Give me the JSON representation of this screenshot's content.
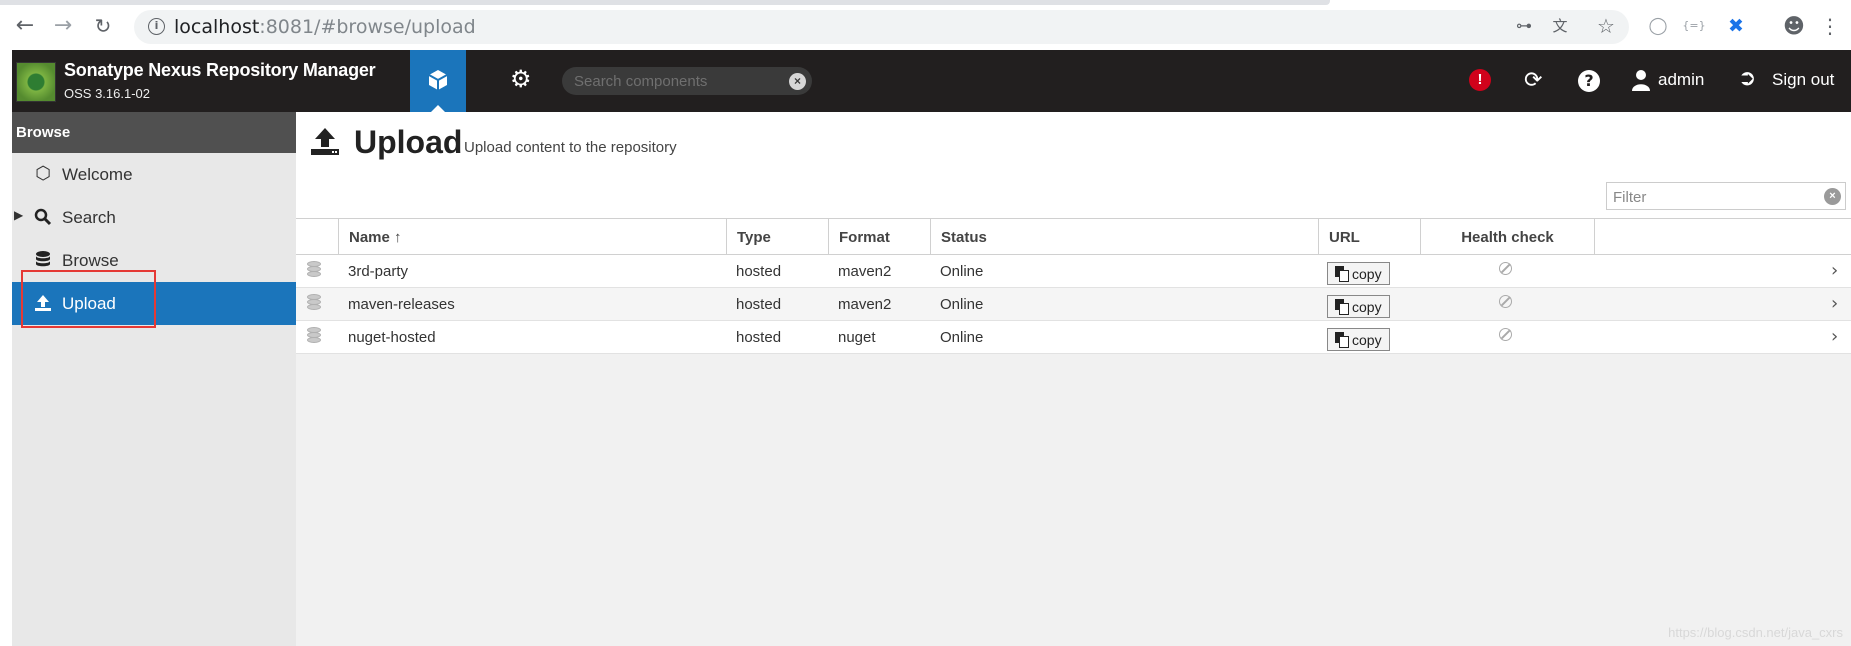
{
  "browser": {
    "url_host": "localhost",
    "url_rest": ":8081/#browse/upload"
  },
  "header": {
    "title": "Sonatype Nexus Repository Manager",
    "version": "OSS 3.16.1-02",
    "search_placeholder": "Search components",
    "user": "admin",
    "signout": "Sign out",
    "accent_color": "#1b75bb"
  },
  "sidebar": {
    "header": "Browse",
    "items": [
      {
        "label": "Welcome",
        "icon": "hexagon-icon"
      },
      {
        "label": "Search",
        "icon": "search-icon"
      },
      {
        "label": "Browse",
        "icon": "database-icon"
      },
      {
        "label": "Upload",
        "icon": "upload-icon",
        "active": true
      }
    ]
  },
  "page": {
    "title": "Upload",
    "subtitle": "Upload content to the repository",
    "filter_placeholder": "Filter"
  },
  "grid": {
    "columns": [
      "Name ↑",
      "Type",
      "Format",
      "Status",
      "URL",
      "Health check"
    ],
    "copy_label": "copy",
    "rows": [
      {
        "name": "3rd-party",
        "type": "hosted",
        "format": "maven2",
        "status": "Online"
      },
      {
        "name": "maven-releases",
        "type": "hosted",
        "format": "maven2",
        "status": "Online"
      },
      {
        "name": "nuget-hosted",
        "type": "hosted",
        "format": "nuget",
        "status": "Online"
      }
    ]
  },
  "watermark": "https://blog.csdn.net/java_cxrs"
}
